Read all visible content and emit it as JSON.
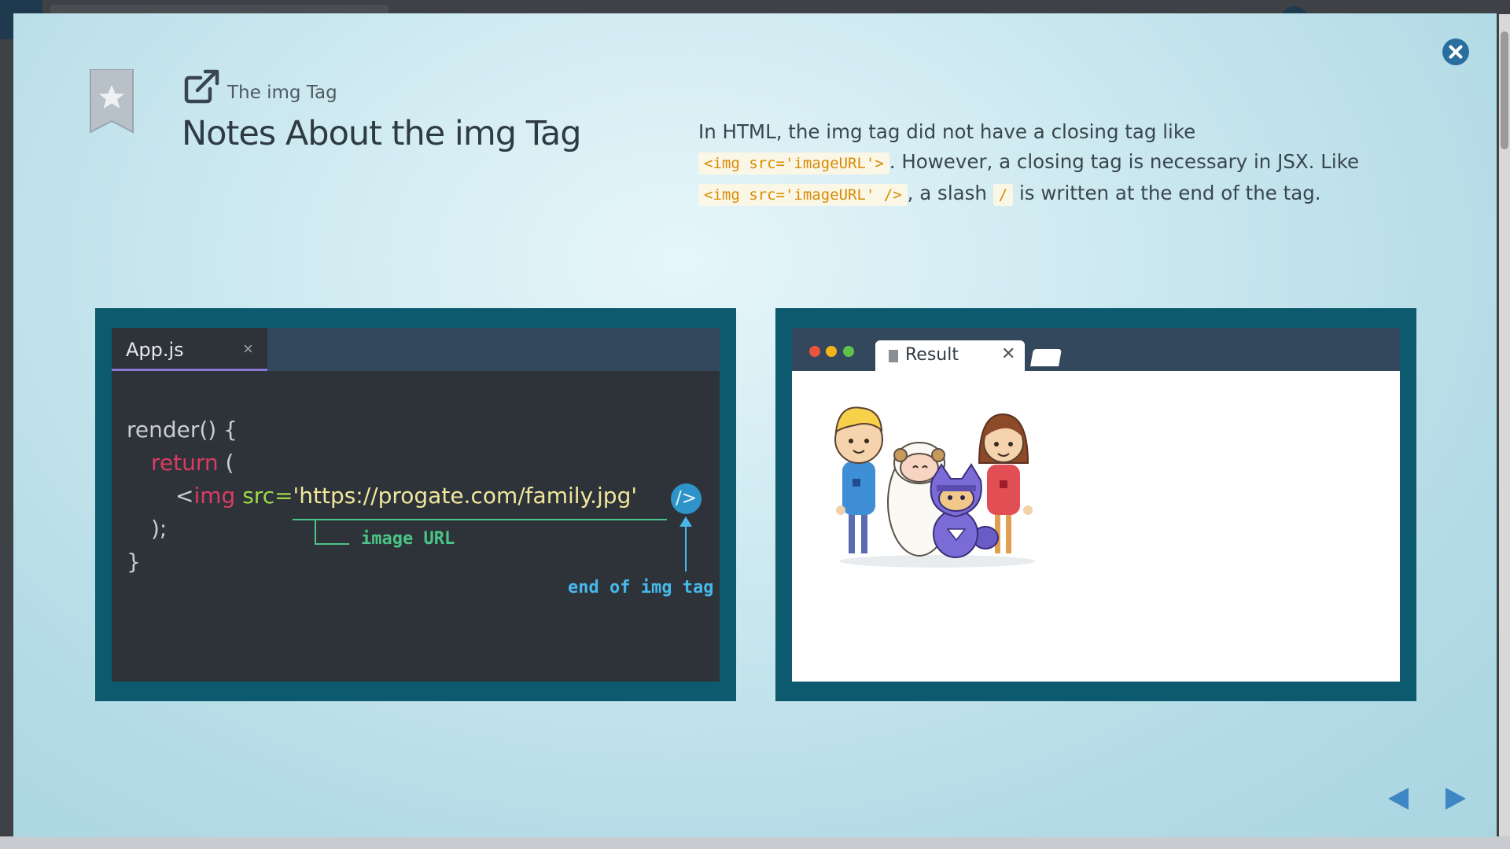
{
  "slide": {
    "subtitle": "The img Tag",
    "title": "Notes About the img Tag",
    "description": {
      "l1_text": "In HTML, the img tag did not have a closing tag like",
      "l2_code": "<img src='imageURL'>",
      "l2_text": ". However, a closing tag is necessary in JSX. Like",
      "l3_code": "<img src='imageURL' />",
      "l3_text_a": ", a slash",
      "l3_code_slash": "/",
      "l3_text_b": "is written at the end of the tag."
    }
  },
  "editor": {
    "tab_label": "App.js",
    "tab_close": "×",
    "code": {
      "line1": "render() {",
      "line2_kw": "return",
      "line2_paren": "(",
      "line3_lt": "<",
      "line3_tag": "img",
      "line3_attr": "src=",
      "line3_str": "'https://progate.com/family.jpg'",
      "line3_slash": "/>",
      "line4": ");",
      "line5": "}"
    },
    "annotations": {
      "url_note": "image URL",
      "end_note": "end of img tag"
    }
  },
  "browser": {
    "tab_label": "Result",
    "tab_close": "✕"
  },
  "colors": {
    "accent": "#0d5a6f",
    "code_chip": "#d98a05",
    "url_note": "#4ac586",
    "end_note": "#47b8ea",
    "nav": "#3f87c4"
  },
  "icons": [
    "bookmark-star-icon",
    "external-link-icon",
    "close-circle-icon",
    "previous-arrow-icon",
    "next-arrow-icon"
  ]
}
